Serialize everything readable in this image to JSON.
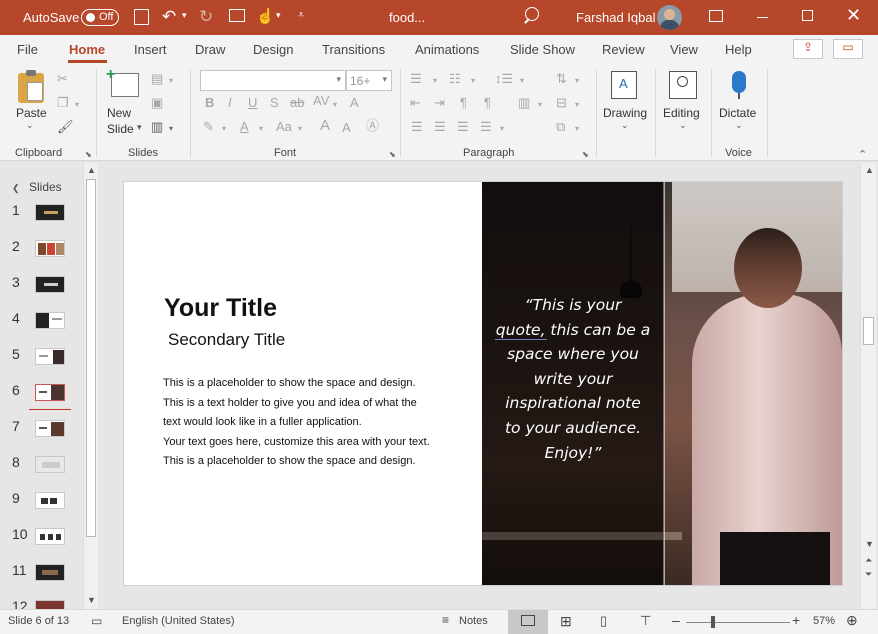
{
  "titlebar": {
    "autosave_label": "AutoSave",
    "autosave_state": "Off",
    "doc_name": "food...",
    "user_name": "Farshad Iqbal"
  },
  "ribbon_tabs": [
    "File",
    "Home",
    "Insert",
    "Draw",
    "Design",
    "Transitions",
    "Animations",
    "Slide Show",
    "Review",
    "View",
    "Help"
  ],
  "ribbon": {
    "paste_label": "Paste",
    "new_slide_label_1": "New",
    "new_slide_label_2": "Slide",
    "font_size": "16+",
    "drawing_label": "Drawing",
    "editing_label": "Editing",
    "dictate_label": "Dictate",
    "groups": {
      "clipboard": "Clipboard",
      "slides": "Slides",
      "font": "Font",
      "paragraph": "Paragraph",
      "voice": "Voice"
    }
  },
  "thumbnails": {
    "header": "Slides",
    "numbers": [
      "1",
      "2",
      "3",
      "4",
      "5",
      "6",
      "7",
      "8",
      "9",
      "10",
      "11",
      "12"
    ]
  },
  "slide": {
    "title": "Your Title",
    "subtitle": "Secondary Title",
    "body_lines": [
      "This is a placeholder to show the space and design.",
      "This is a text holder to give you and idea of what the",
      "text would look like in a fuller application.",
      "Your text goes here, customize this area with your text.",
      "This is a placeholder to show the space and design."
    ],
    "quote_lines": [
      "“This is your",
      "quote, this can be a",
      "space where you",
      "write your",
      "inspirational note",
      "to your audience.",
      "Enjoy!”"
    ]
  },
  "statusbar": {
    "slide_info": "Slide 6 of 13",
    "language": "English (United States)",
    "notes_label": "Notes",
    "zoom_minus": "–",
    "zoom_plus": "+",
    "zoom_level": "57%"
  },
  "colors": {
    "accent": "#b7472a",
    "ribbon_bg": "#f3f3f3",
    "workspace_bg": "#e6e6e6"
  }
}
